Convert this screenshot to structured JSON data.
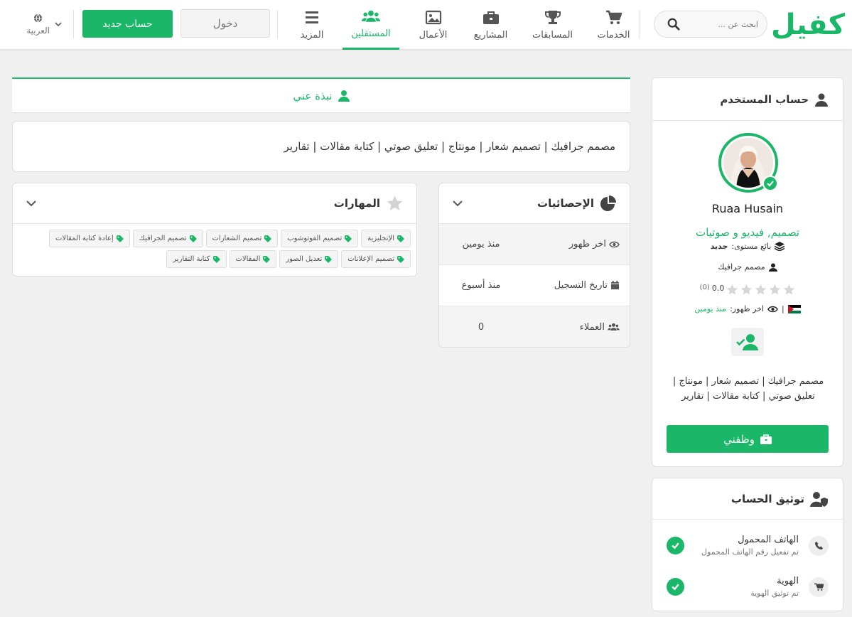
{
  "header": {
    "logo_text": "كفيل",
    "search_placeholder": "ابحث عن ...",
    "nav": [
      {
        "label": "الخدمات",
        "icon": "cart-icon"
      },
      {
        "label": "المسابقات",
        "icon": "trophy-icon"
      },
      {
        "label": "المشاريع",
        "icon": "briefcase-icon"
      },
      {
        "label": "الأعمال",
        "icon": "image-icon"
      },
      {
        "label": "المستقلين",
        "icon": "users-icon",
        "active": true
      },
      {
        "label": "المزيد",
        "icon": "menu-icon"
      }
    ],
    "login_label": "دخول",
    "signup_label": "حساب جديد",
    "language_label": "العربية"
  },
  "profile": {
    "section_title": "حساب المستخدم",
    "name": "Ruaa Husain",
    "headline": "تصميم, فيديو و صوتيات",
    "level_label": "بائع مستوى:",
    "level_value": "جديد",
    "role": "مصمم جرافيك",
    "rating": "0.0",
    "rating_count": "(0)",
    "last_seen_label": "اخر ظهور:",
    "last_seen_value": "منذ يومين",
    "bio": "مصمم جرافيك | تصميم شعار | مونتاج | تعليق صوتي | كتابة مقالات | تقارير",
    "hire_label": "وظفني"
  },
  "verification": {
    "title": "توثيق الحساب",
    "items": [
      {
        "title": "الهاتف المحمول",
        "subtitle": "تم تفعيل رقم الهاتف المحمول",
        "icon": "phone-icon"
      },
      {
        "title": "الهوية",
        "subtitle": "تم توثيق الهوية",
        "icon": "cart-icon"
      }
    ]
  },
  "about": {
    "tab_label": "نبذة عني",
    "text": "مصمم جرافيك | تصميم شعار | مونتاج | تعليق صوتي | كتابة مقالات | تقارير"
  },
  "stats": {
    "title": "الإحصائيات",
    "rows": [
      {
        "label": "اخر ظهور",
        "value": "منذ يومين",
        "icon": "eye-icon"
      },
      {
        "label": "تاريخ التسجيل",
        "value": "منذ أسبوع",
        "icon": "calendar-icon"
      },
      {
        "label": "العملاء",
        "value": "0",
        "icon": "users-icon"
      }
    ]
  },
  "skills": {
    "title": "المهارات",
    "tags": [
      "الإنجليزية",
      "تصميم الفوتوشوب",
      "تصميم الشعارات",
      "تصميم الجرافيك",
      "إعادة كتابة المقالات",
      "تصميم الإعلانات",
      "تعديل الصور",
      "المقالات",
      "كتابة التقارير"
    ]
  },
  "colors": {
    "accent": "#1bb769",
    "background": "#f0f0f0"
  }
}
